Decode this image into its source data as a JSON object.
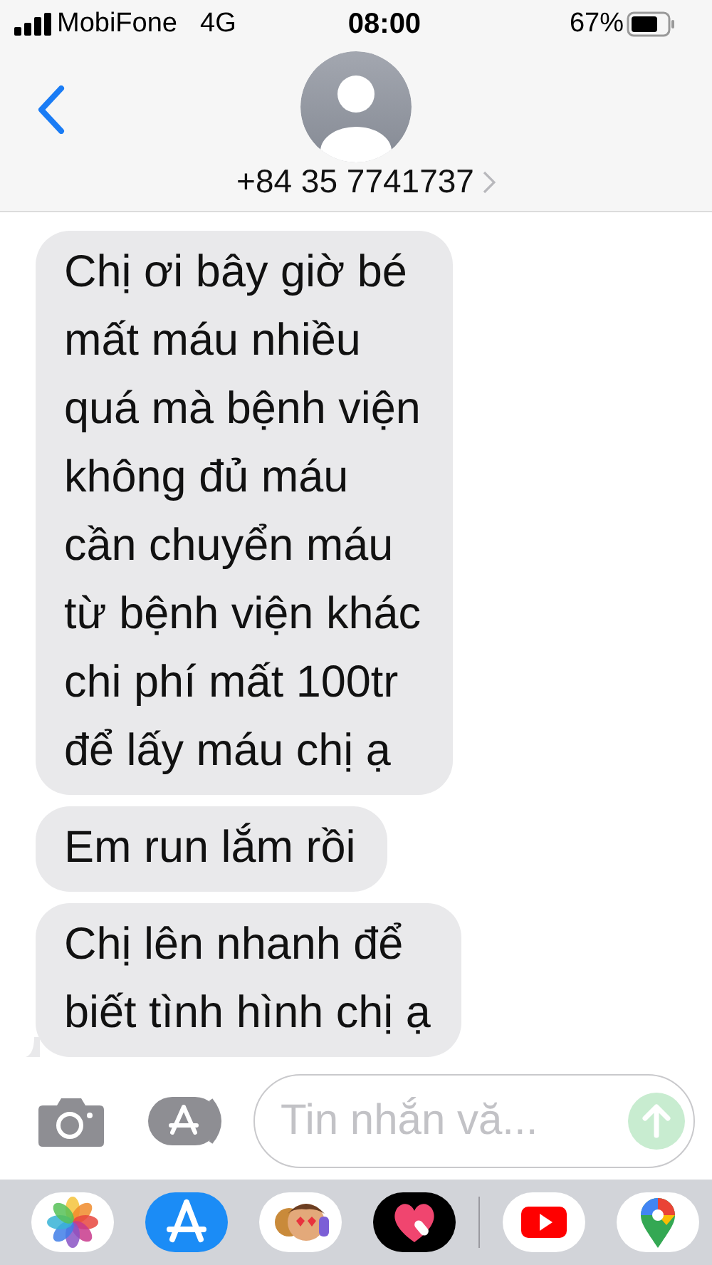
{
  "status_bar": {
    "carrier": "MobiFone",
    "network": "4G",
    "time": "08:00",
    "battery": "67%"
  },
  "header": {
    "contact": "+84 35 7741737"
  },
  "messages": [
    {
      "text": "Chị ơi bây giờ bé\nmất máu nhiều\nquá mà bệnh viện\nkhông đủ máu\ncần chuyển máu\ntừ bệnh viện khác\nchi phí mất 100tr\nđể lấy máu chị ạ",
      "tail": false
    },
    {
      "text": "Em run lắm rồi",
      "tail": false
    },
    {
      "text": "Chị lên nhanh để\nbiết tình hình chị ạ",
      "tail": true
    }
  ],
  "composer": {
    "placeholder": "Tin nhắn vă..."
  },
  "app_drawer": [
    {
      "kind": "photos"
    },
    {
      "kind": "appstore"
    },
    {
      "kind": "memoji"
    },
    {
      "kind": "heart"
    },
    {
      "kind": "youtube"
    },
    {
      "kind": "maps"
    }
  ]
}
